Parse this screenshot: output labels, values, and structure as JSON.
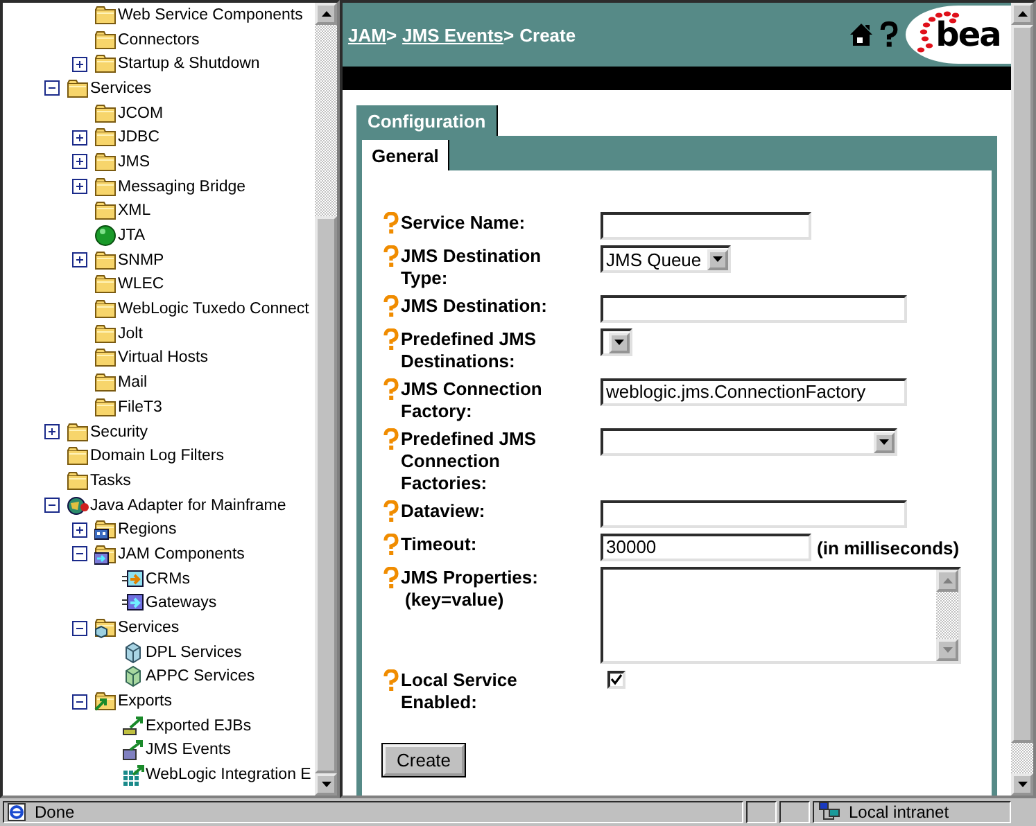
{
  "tree": {
    "continued": [
      {
        "label": "Web Service Components",
        "kind": "folder"
      },
      {
        "label": "Connectors",
        "kind": "folder"
      },
      {
        "label": "Startup & Shutdown",
        "kind": "folder",
        "expanded": false
      }
    ],
    "items": [
      {
        "label": "Services",
        "kind": "folder",
        "expanded": true,
        "children": [
          {
            "label": "JCOM",
            "kind": "folder"
          },
          {
            "label": "JDBC",
            "kind": "folder",
            "expanded": false
          },
          {
            "label": "JMS",
            "kind": "folder",
            "expanded": false
          },
          {
            "label": "Messaging Bridge",
            "kind": "folder",
            "expanded": false
          },
          {
            "label": "XML",
            "kind": "folder"
          },
          {
            "label": "JTA",
            "kind": "ball"
          },
          {
            "label": "SNMP",
            "kind": "folder",
            "expanded": false
          },
          {
            "label": "WLEC",
            "kind": "folder"
          },
          {
            "label": "WebLogic Tuxedo Connect",
            "kind": "folder"
          },
          {
            "label": "Jolt",
            "kind": "folder"
          },
          {
            "label": "Virtual Hosts",
            "kind": "folder"
          },
          {
            "label": "Mail",
            "kind": "folder"
          },
          {
            "label": "FileT3",
            "kind": "folder"
          }
        ]
      },
      {
        "label": "Security",
        "kind": "folder",
        "expanded": false
      },
      {
        "label": "Domain Log Filters",
        "kind": "folder"
      },
      {
        "label": "Tasks",
        "kind": "folder"
      },
      {
        "label": "Java Adapter for Mainframe",
        "kind": "adapter",
        "expanded": true,
        "children": [
          {
            "label": "Regions",
            "kind": "regions",
            "expanded": false
          },
          {
            "label": "JAM Components",
            "kind": "components",
            "expanded": true,
            "children": [
              {
                "label": "CRMs",
                "kind": "crm"
              },
              {
                "label": "Gateways",
                "kind": "gateway"
              }
            ]
          },
          {
            "label": "Services",
            "kind": "services",
            "expanded": true,
            "children": [
              {
                "label": "DPL Services",
                "kind": "dpl"
              },
              {
                "label": "APPC Services",
                "kind": "appc"
              }
            ]
          },
          {
            "label": "Exports",
            "kind": "exports",
            "expanded": true,
            "children": [
              {
                "label": "Exported EJBs",
                "kind": "ejb"
              },
              {
                "label": "JMS Events",
                "kind": "jms"
              },
              {
                "label": "WebLogic Integration E",
                "kind": "integration"
              }
            ]
          }
        ]
      }
    ]
  },
  "header": {
    "breadcrumb": [
      {
        "label": "JAM",
        "link": true,
        "separator": ">"
      },
      {
        "label": "JMS Events",
        "link": true,
        "separator": ">"
      },
      {
        "label": "Create",
        "link": false
      }
    ],
    "logo": "bea"
  },
  "tabs": [
    {
      "label": "Configuration",
      "selected": true
    }
  ],
  "subtabs": [
    {
      "label": "General",
      "selected": true
    }
  ],
  "form": {
    "fields": [
      {
        "kind": "text",
        "label": "Service Name:"
      },
      {
        "kind": "select",
        "label": "JMS Destination Type:",
        "value": "JMS Queue"
      },
      {
        "kind": "text",
        "label": "JMS Destination:"
      },
      {
        "kind": "select",
        "label": "Predefined JMS Destinations:"
      },
      {
        "kind": "text",
        "label": "JMS Connection Factory:",
        "value": "weblogic.jms.ConnectionFactory"
      },
      {
        "kind": "select",
        "label": "Predefined JMS Connection Factories:"
      },
      {
        "kind": "text",
        "label": "Dataview:"
      },
      {
        "kind": "text",
        "label": "Timeout:",
        "value": "30000",
        "suffix": "(in milliseconds)"
      },
      {
        "kind": "textarea",
        "label": "JMS Properties:",
        "hint": "(key=value)"
      },
      {
        "kind": "checkbox",
        "label": "Local Service Enabled:",
        "checked": true
      }
    ],
    "submit": "Create"
  },
  "status_bar": {
    "text": "Done",
    "zone": "Local intranet"
  }
}
